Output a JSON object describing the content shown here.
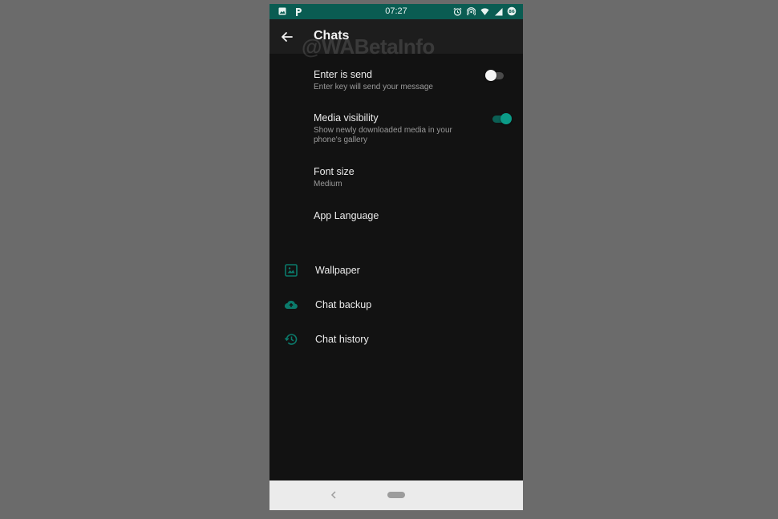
{
  "status_bar": {
    "time": "07:27",
    "left_icons": [
      "image-icon",
      "parking-p-icon"
    ],
    "right_icons": [
      "alarm-icon",
      "hotspot-icon",
      "wifi-icon",
      "signal-icon",
      "battery-icon"
    ],
    "battery_level": "86"
  },
  "app_bar": {
    "title": "Chats",
    "back_icon": "arrow-left-icon"
  },
  "watermark": "@WABetaInfo",
  "settings": [
    {
      "label": "Enter is send",
      "subtitle": "Enter key will send your message",
      "toggle": false
    },
    {
      "label": "Media visibility",
      "subtitle": "Show newly downloaded media in your phone's gallery",
      "toggle": true
    },
    {
      "label": "Font size",
      "subtitle": "Medium"
    },
    {
      "label": "App Language"
    }
  ],
  "actions": [
    {
      "label": "Wallpaper",
      "icon": "wallpaper-icon"
    },
    {
      "label": "Chat backup",
      "icon": "cloud-upload-icon"
    },
    {
      "label": "Chat history",
      "icon": "history-icon"
    }
  ],
  "colors": {
    "accent": "#0b9b87",
    "status_bar": "#0a5c52",
    "background": "#121212",
    "app_bar": "#1d1d1d"
  }
}
